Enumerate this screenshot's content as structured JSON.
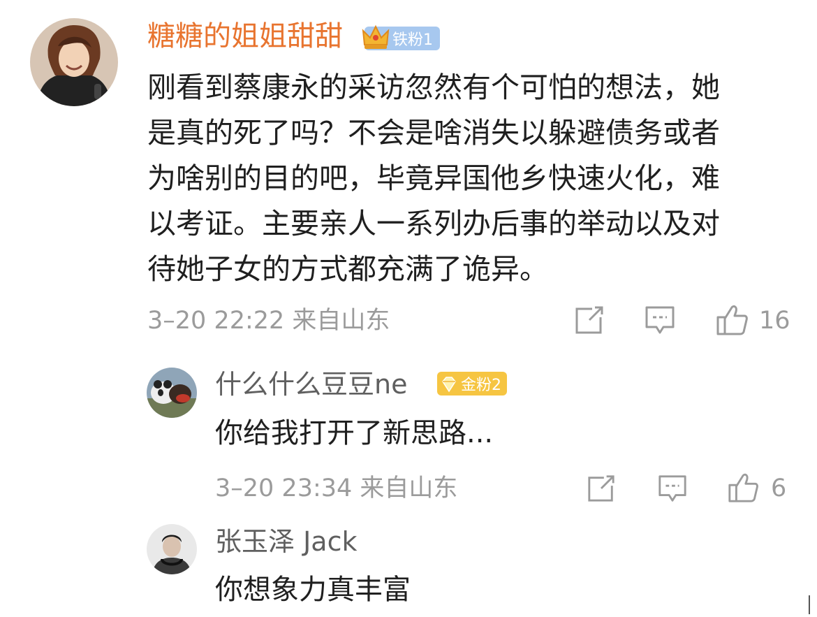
{
  "comment": {
    "author": "糖糖的姐姐甜甜",
    "badge": "铁粉1",
    "text_lines": [
      "刚看到蔡康永的采访忽然有个可怕的想法，她",
      "是真的死了吗？不会是啥消失以躲避债务或者",
      "为啥别的目的吧，毕竟异国他乡快速火化，难",
      "以考证。主要亲人一系列办后事的举动以及对",
      "待她子女的方式都充满了诡异。"
    ],
    "meta": "3–20 22:22 来自山东",
    "likes": "16"
  },
  "replies": [
    {
      "author": "什么什么豆豆ne",
      "badge": "金粉2",
      "text": "你给我打开了新思路...",
      "meta": "3–20 23:34 来自山东",
      "likes": "6"
    },
    {
      "author": "张玉泽 Jack",
      "text": "你想象力真丰富"
    }
  ],
  "colors": {
    "username_highlight": "#e8742f",
    "username_normal": "#5f5f5f",
    "meta_gray": "#9b9b9b",
    "badge_iron": "#a7c8ef",
    "badge_gold": "#f6c542"
  },
  "icons": {
    "share": "share-icon",
    "comment": "comment-icon",
    "like": "like-icon",
    "crown": "crown-icon",
    "gem": "gem-icon"
  }
}
